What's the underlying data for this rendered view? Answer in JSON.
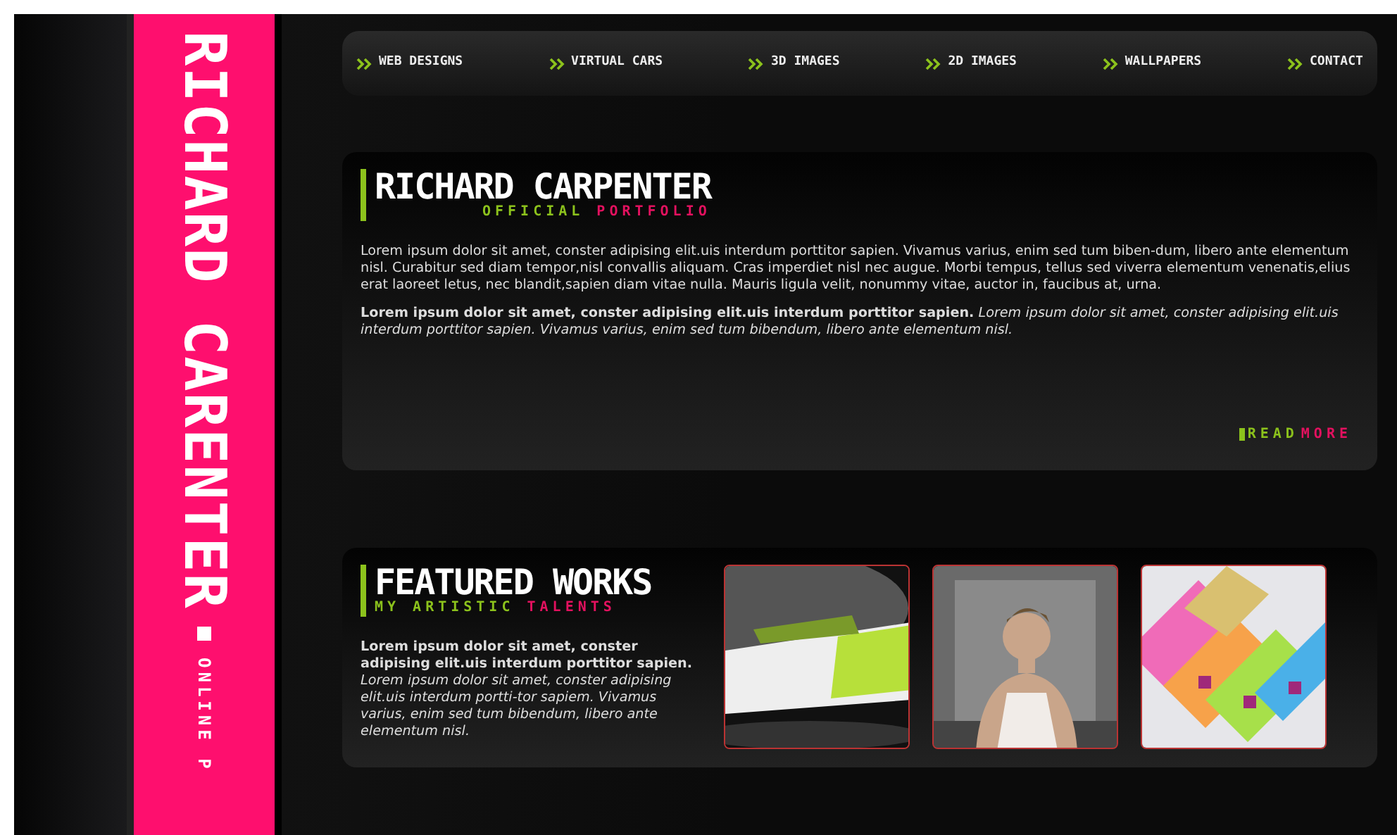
{
  "sidebar": {
    "title": "RICHARD CARENTER",
    "tagline": "ONLINE P"
  },
  "nav": [
    {
      "label": "WEB DESIGNS"
    },
    {
      "label": "VIRTUAL CARS"
    },
    {
      "label": "3D IMAGES"
    },
    {
      "label": "2D IMAGES"
    },
    {
      "label": "WALLPAPERS"
    },
    {
      "label": "CONTACT"
    }
  ],
  "intro": {
    "title": "RICHARD CARPENTER",
    "subtitle": [
      {
        "text": "OFFICIAL",
        "color": "#8cc21c"
      },
      {
        "text": "PORTFOLIO",
        "color": "#e3115f"
      }
    ],
    "paragraphs": [
      "Lorem ipsum dolor sit amet, conster adipising elit.uis interdum porttitor sapien. Vivamus varius, enim sed tum biben-dum, libero ante elementum nisl. Curabitur sed diam tempor,nisl convallis aliquam. Cras imperdiet nisl nec augue. Morbi tempus, tellus sed viverra elementum venenatis,elius erat laoreet letus, nec blandit,sapien diam vitae nulla. Mauris ligula velit, nonummy vitae, auctor in, faucibus at, urna.",
      "**Lorem ipsum dolor sit amet, conster adipising elit.uis interdum porttitor sapien.** *Lorem ipsum dolor sit amet, conster adipising elit.uis interdum porttitor sapien. Vivamus varius, enim sed tum bibendum, libero ante elementum nisl.*"
    ],
    "link": [
      {
        "text": "READ",
        "color": "#8cc21c"
      },
      {
        "text": "MORE",
        "color": "#e3115f"
      }
    ]
  },
  "featured": {
    "title": "FEATURED WORKS",
    "subtitle": [
      {
        "text": "MY ARTISTIC",
        "color": "#8cc21c"
      },
      {
        "text": "TALENTS",
        "color": "#e3115f"
      }
    ],
    "text": "**Lorem ipsum dolor sit amet, conster adipising elit.uis interdum porttitor sapien.** *Lorem ipsum dolor sit amet, conster adipising elit.uis interdum portti-tor sapiem. Vivamus varius, enim sed tum bibendum, libero ante elementum nisl.*"
  }
}
